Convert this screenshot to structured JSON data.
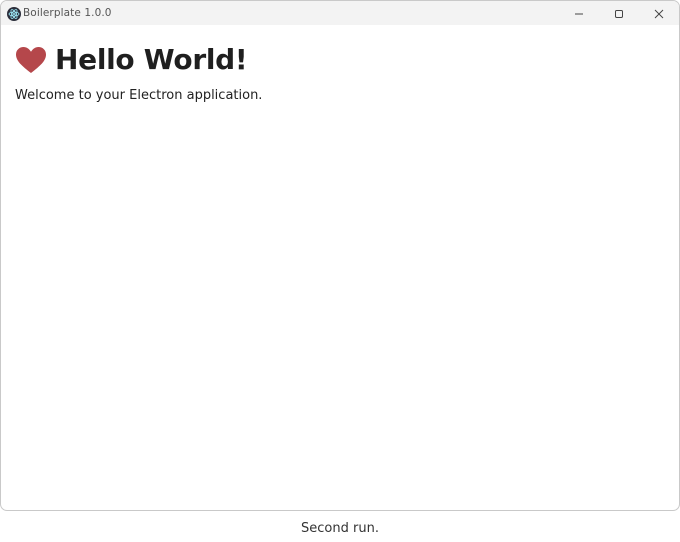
{
  "window": {
    "title": "Boilerplate 1.0.0",
    "controls": {
      "minimize_icon": "minimize-icon",
      "maximize_icon": "maximize-icon",
      "close_icon": "close-icon"
    }
  },
  "main": {
    "heading": "Hello World!",
    "heading_icon": "heart-icon",
    "heading_icon_color": "#b5474b",
    "welcome": "Welcome to your Electron application."
  },
  "caption": "Second run."
}
